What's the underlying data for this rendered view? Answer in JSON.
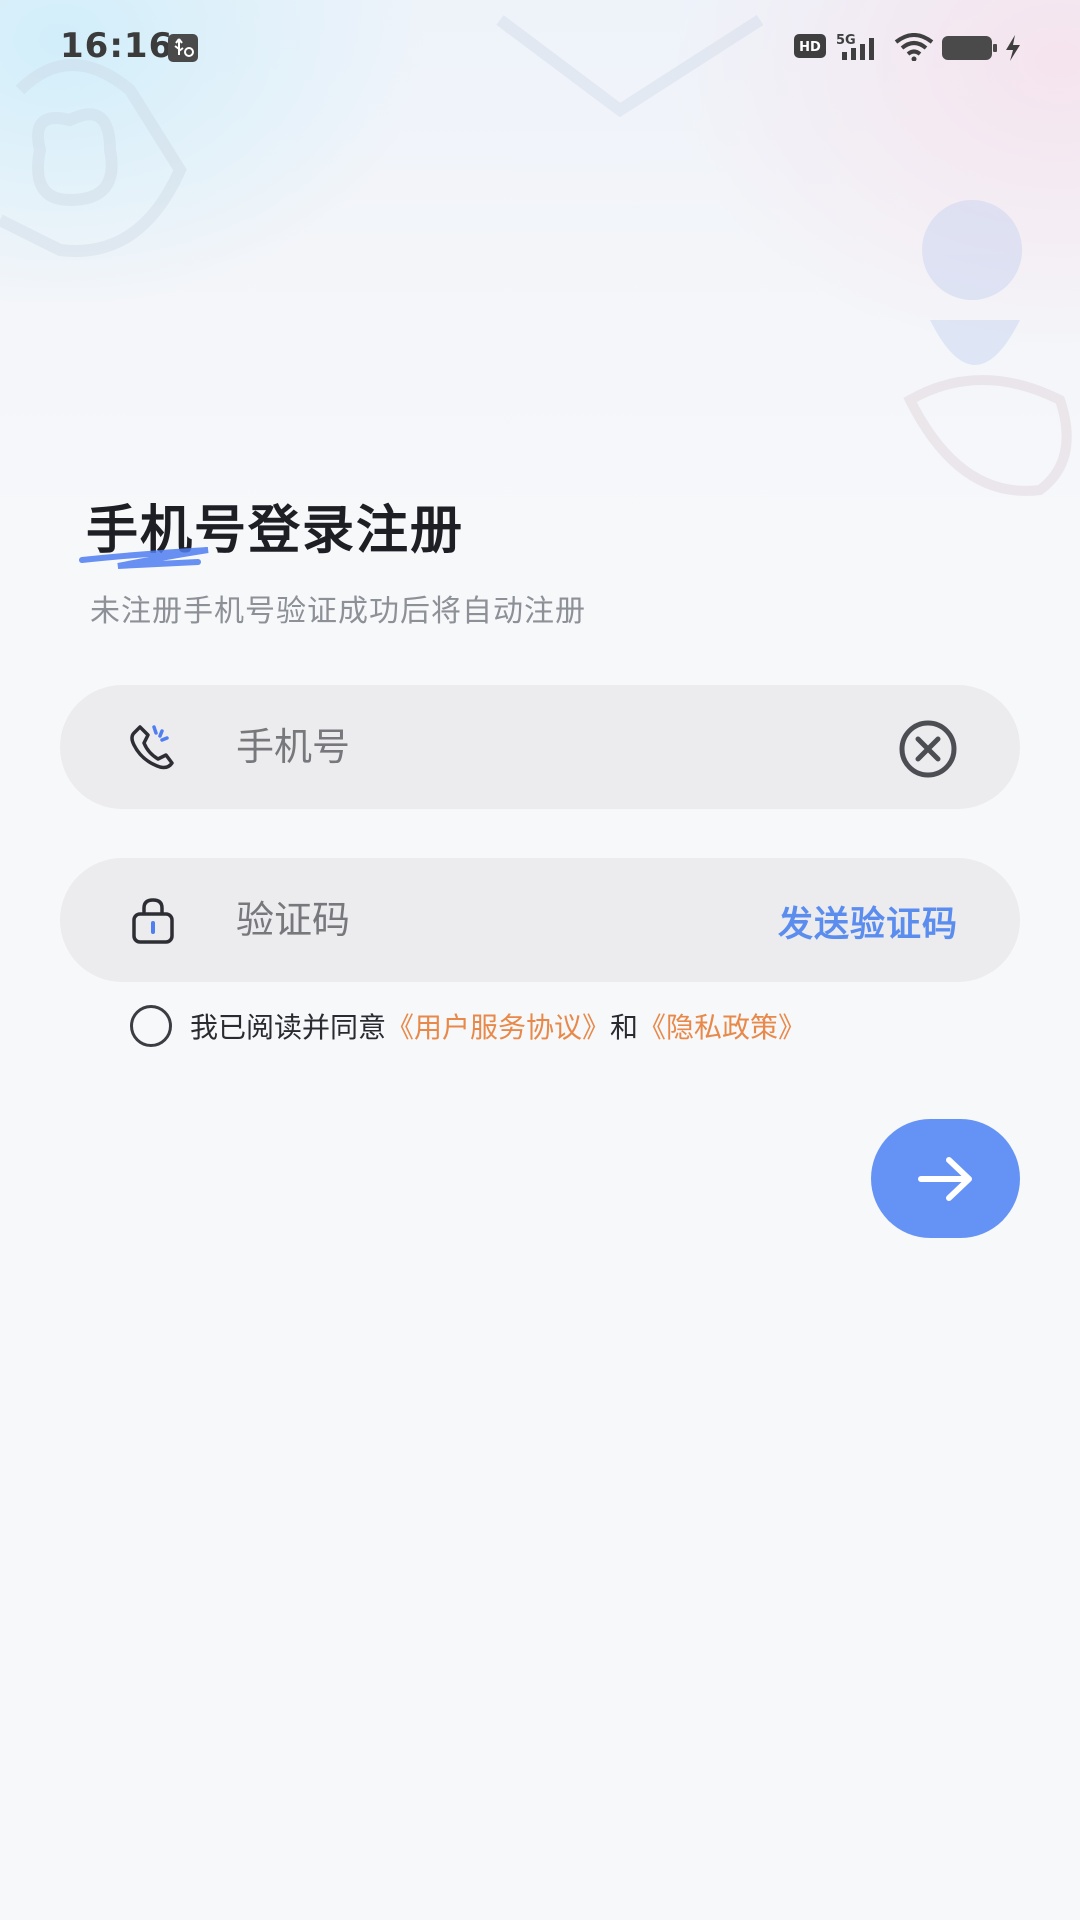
{
  "status_bar": {
    "time": "16:16",
    "hd_badge": "HD",
    "network": "5G",
    "icons": [
      "usb-debug-icon",
      "hd-icon",
      "signal-5g-icon",
      "wifi-icon",
      "battery-icon",
      "charging-icon"
    ]
  },
  "login": {
    "title": "手机号登录注册",
    "subtitle": "未注册手机号验证成功后将自动注册",
    "phone_field": {
      "placeholder": "手机号",
      "value": "",
      "icon": "phone-icon",
      "clear_icon": "clear-icon"
    },
    "code_field": {
      "placeholder": "验证码",
      "value": "",
      "icon": "lock-icon",
      "send_label": "发送验证码"
    },
    "agreement": {
      "checked": false,
      "prefix": "我已阅读并同意",
      "terms_link": "《用户服务协议》",
      "connector": "和",
      "privacy_link": "《隐私政策》"
    },
    "submit_icon": "arrow-right-icon"
  },
  "colors": {
    "accent": "#5b8def",
    "submit_button": "#6593f5",
    "link": "#e8894a",
    "field_background": "#ececef",
    "page_background": "#f7f8fa"
  }
}
